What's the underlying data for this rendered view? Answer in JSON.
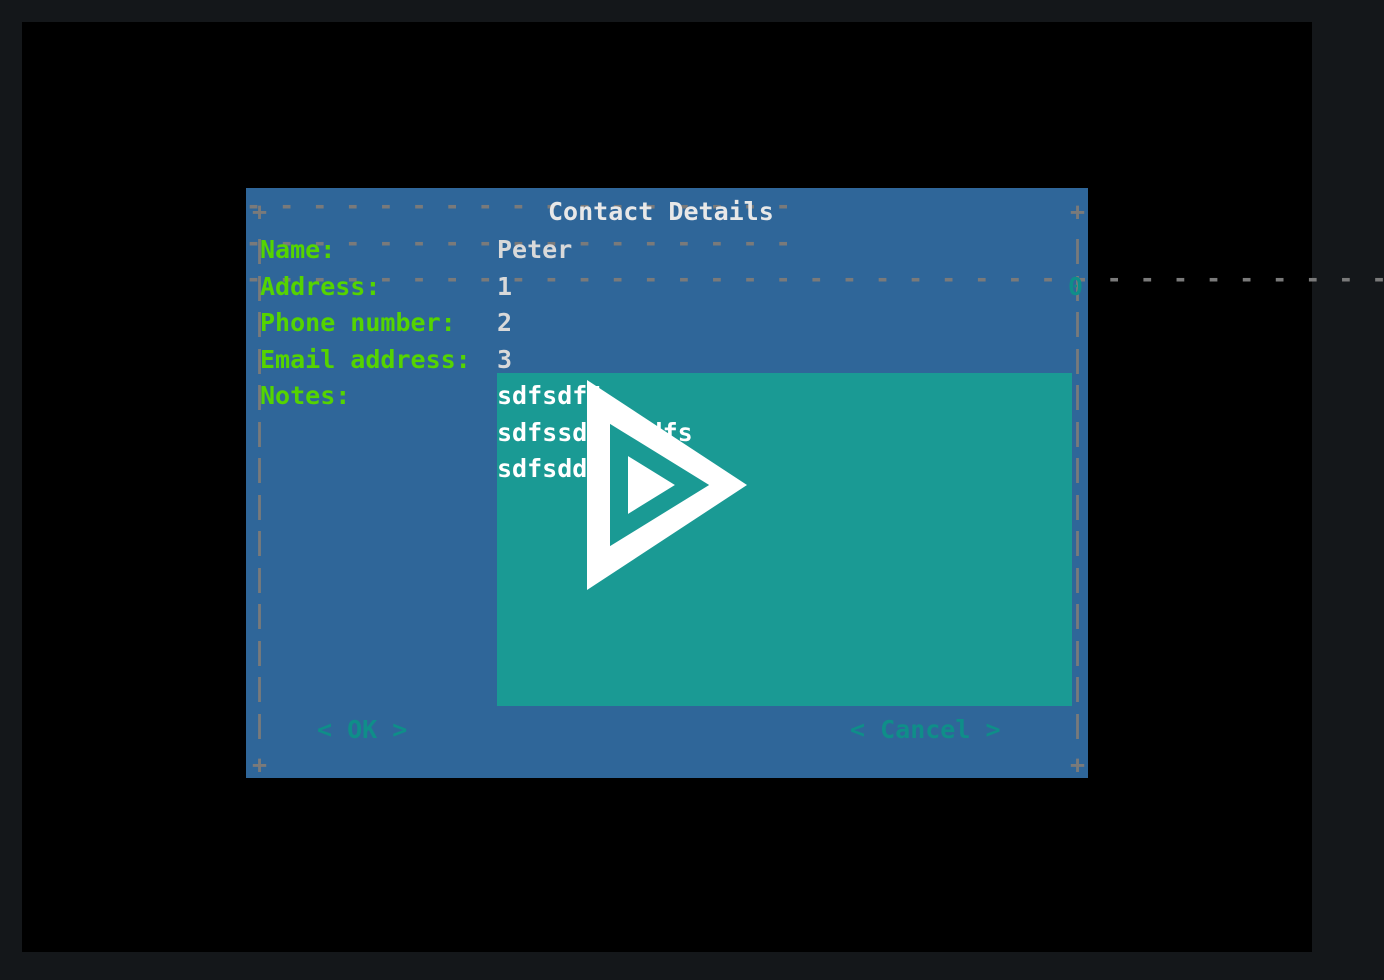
{
  "dialog": {
    "title": "Contact Details",
    "side_marker": "0",
    "fields": {
      "name": {
        "label": "Name:",
        "value": "Peter"
      },
      "address": {
        "label": "Address:",
        "value": "1"
      },
      "phone": {
        "label": "Phone number:",
        "value": "2"
      },
      "email": {
        "label": "Email address:",
        "value": "3"
      },
      "notes": {
        "label": "Notes:",
        "lines": [
          "sdfsdf4",
          "sdfssdfsdfdfs",
          "sdfsddf"
        ]
      }
    },
    "buttons": {
      "ok": "< OK >",
      "cancel": "< Cancel >"
    }
  }
}
